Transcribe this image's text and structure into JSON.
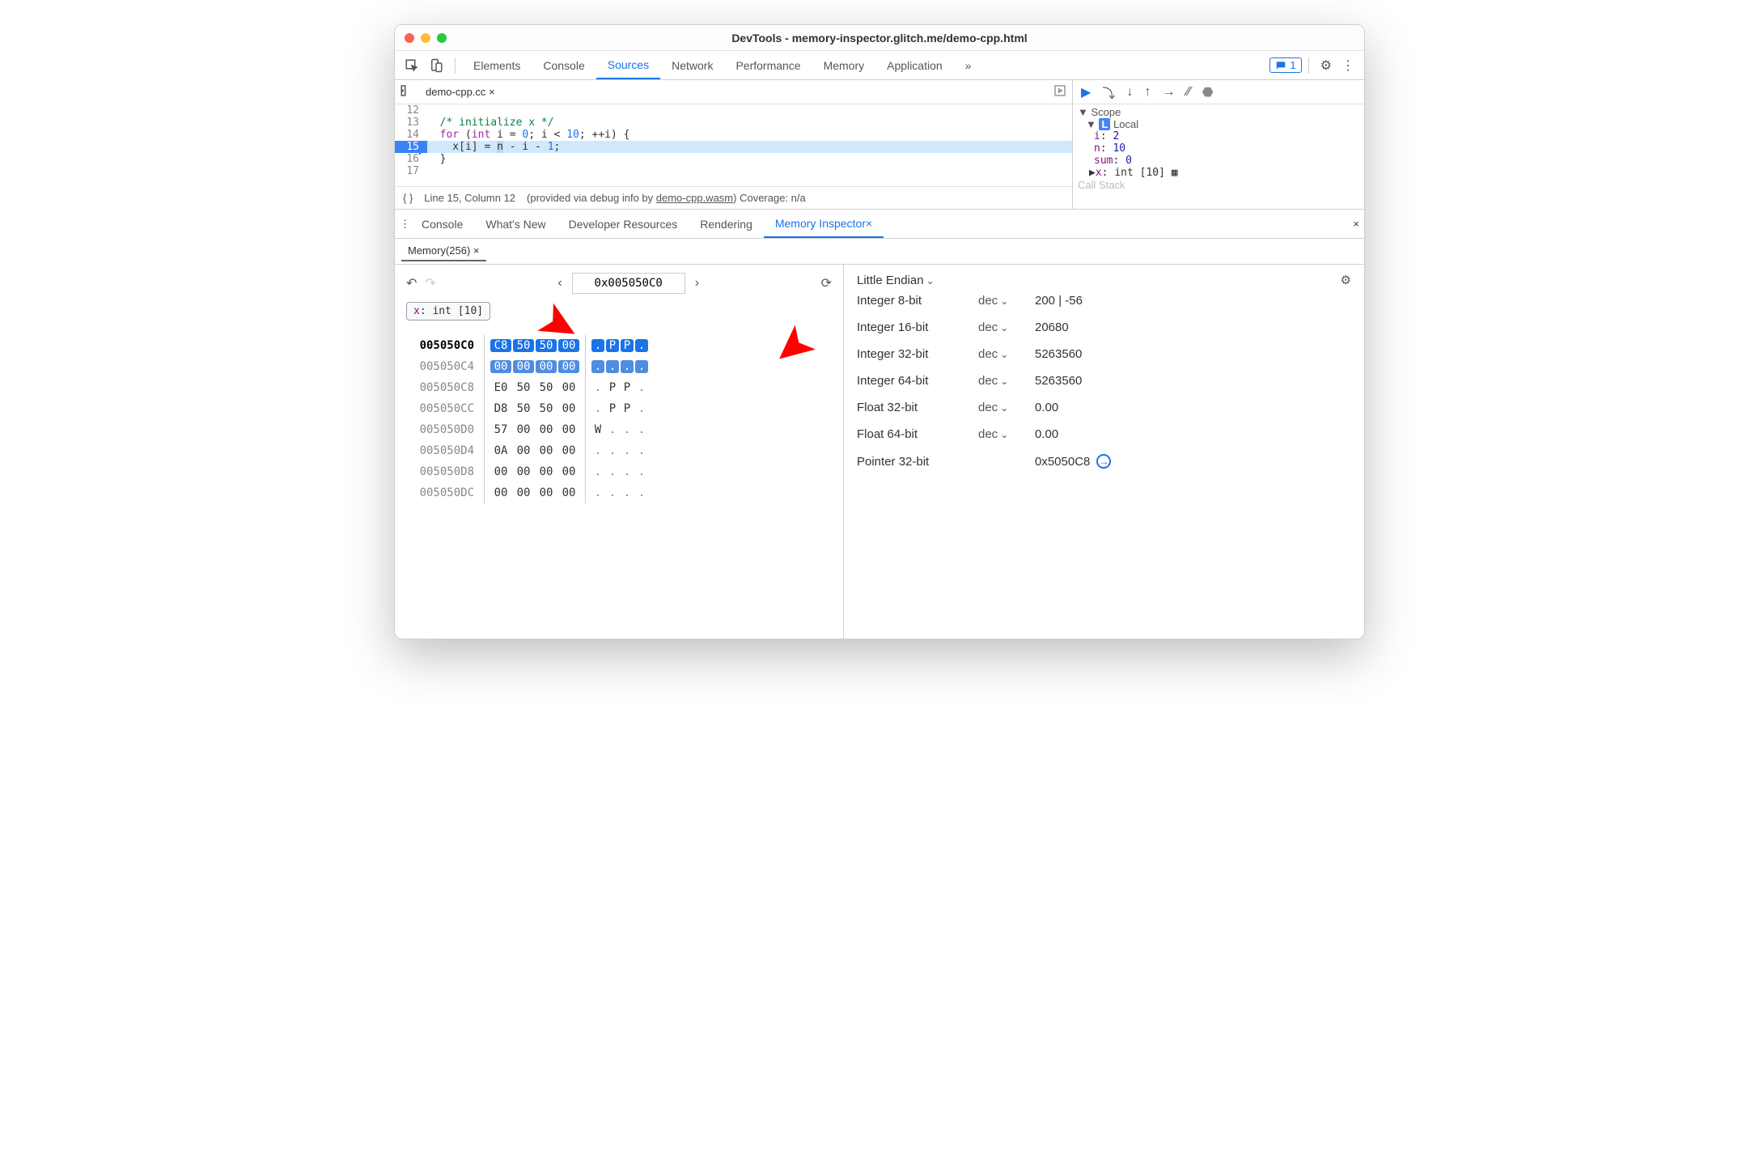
{
  "window": {
    "title": "DevTools - memory-inspector.glitch.me/demo-cpp.html"
  },
  "mainTabs": [
    "Elements",
    "Console",
    "Sources",
    "Network",
    "Performance",
    "Memory",
    "Application"
  ],
  "mainTabActive": "Sources",
  "messageCount": "1",
  "file": {
    "name": "demo-cpp.cc"
  },
  "code": {
    "lines": [
      {
        "n": "12",
        "html": ""
      },
      {
        "n": "13",
        "html": "<span class='cmt'>/* initialize x */</span>"
      },
      {
        "n": "14",
        "html": "<span class='kw'>for</span> (<span class='type'>int</span> i = <span class='num'>0</span>; i &lt; <span class='num'>10</span>; ++i) {"
      },
      {
        "n": "15",
        "html": "  x[i] = <span class='hlvar'>n</span> - i - <span class='num'>1</span>;",
        "hl": true
      },
      {
        "n": "16",
        "html": "}"
      },
      {
        "n": "17",
        "html": ""
      }
    ]
  },
  "status": {
    "pos": "Line 15, Column 12",
    "info": "(provided via debug info by ",
    "link": "demo-cpp.wasm",
    "cov": ") Coverage: n/a"
  },
  "scope": {
    "header": "Scope",
    "local": "Local",
    "vars": [
      {
        "k": "i",
        "v": "2"
      },
      {
        "k": "n",
        "v": "10"
      },
      {
        "k": "sum",
        "v": "0"
      }
    ],
    "x": {
      "k": "x",
      "v": "int [10]"
    },
    "callstack": "Call Stack"
  },
  "drawerTabs": [
    "Console",
    "What's New",
    "Developer Resources",
    "Rendering",
    "Memory Inspector"
  ],
  "drawerActive": "Memory Inspector",
  "memTab": "Memory(256)",
  "hex": {
    "address": "0x005050C0",
    "chipK": "x",
    "chipV": "int [10]",
    "rows": [
      {
        "addr": "005050C0",
        "bold": true,
        "sel": "A",
        "bytes": [
          "C8",
          "50",
          "50",
          "00"
        ],
        "ascii": [
          ".",
          "P",
          "P",
          "."
        ]
      },
      {
        "addr": "005050C4",
        "sel": "B",
        "bytes": [
          "00",
          "00",
          "00",
          "00"
        ],
        "ascii": [
          ".",
          ".",
          ".",
          "."
        ]
      },
      {
        "addr": "005050C8",
        "bytes": [
          "E0",
          "50",
          "50",
          "00"
        ],
        "ascii": [
          ".",
          "P",
          "P",
          "."
        ]
      },
      {
        "addr": "005050CC",
        "bytes": [
          "D8",
          "50",
          "50",
          "00"
        ],
        "ascii": [
          ".",
          "P",
          "P",
          "."
        ]
      },
      {
        "addr": "005050D0",
        "bytes": [
          "57",
          "00",
          "00",
          "00"
        ],
        "ascii": [
          "W",
          ".",
          ".",
          "."
        ]
      },
      {
        "addr": "005050D4",
        "bytes": [
          "0A",
          "00",
          "00",
          "00"
        ],
        "ascii": [
          ".",
          ".",
          ".",
          "."
        ]
      },
      {
        "addr": "005050D8",
        "bytes": [
          "00",
          "00",
          "00",
          "00"
        ],
        "ascii": [
          ".",
          ".",
          ".",
          "."
        ]
      },
      {
        "addr": "005050DC",
        "bytes": [
          "00",
          "00",
          "00",
          "00"
        ],
        "ascii": [
          ".",
          ".",
          ".",
          "."
        ]
      }
    ]
  },
  "values": {
    "endian": "Little Endian",
    "rows": [
      {
        "label": "Integer 8-bit",
        "fmt": "dec",
        "val": "200 | -56"
      },
      {
        "label": "Integer 16-bit",
        "fmt": "dec",
        "val": "20680"
      },
      {
        "label": "Integer 32-bit",
        "fmt": "dec",
        "val": "5263560"
      },
      {
        "label": "Integer 64-bit",
        "fmt": "dec",
        "val": "5263560"
      },
      {
        "label": "Float 32-bit",
        "fmt": "dec",
        "val": "0.00"
      },
      {
        "label": "Float 64-bit",
        "fmt": "dec",
        "val": "0.00"
      },
      {
        "label": "Pointer 32-bit",
        "fmt": "",
        "val": "0x5050C8",
        "goto": true
      }
    ]
  }
}
